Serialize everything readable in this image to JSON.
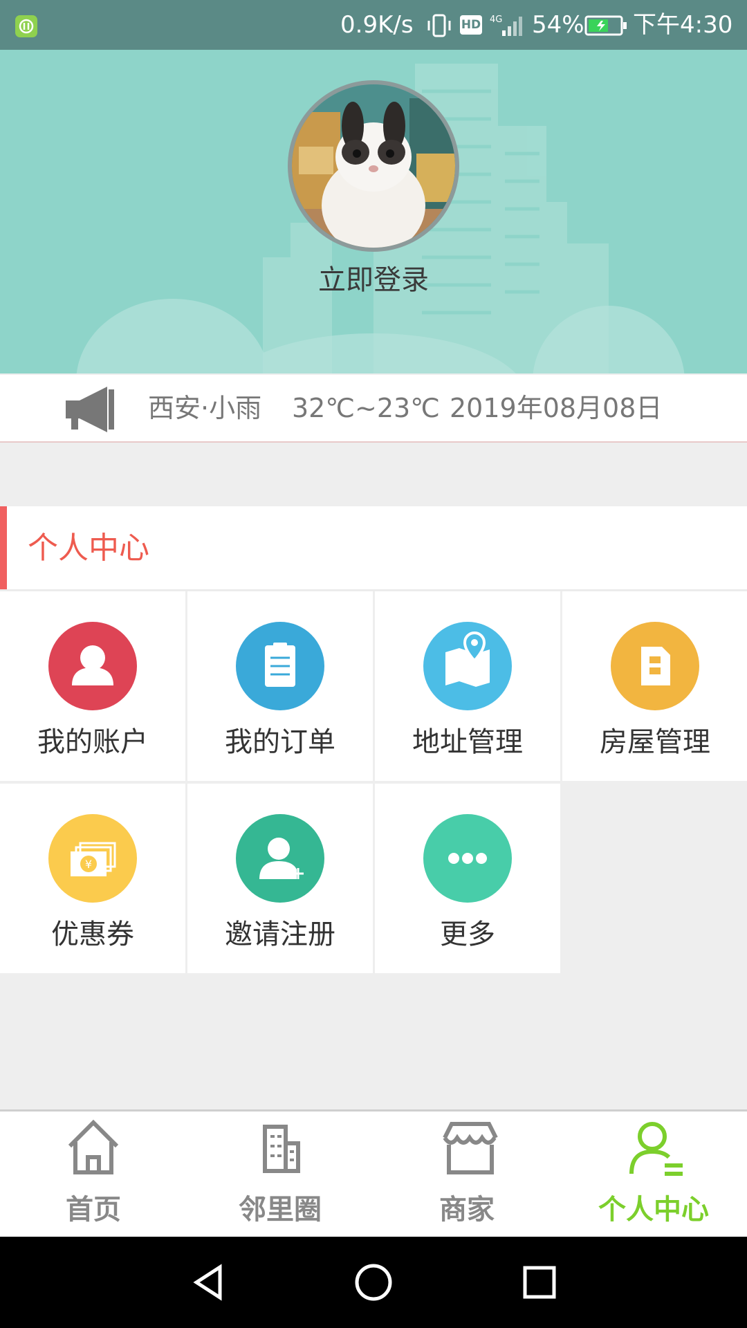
{
  "status_bar": {
    "speed": "0.9K/s",
    "hd": "HD",
    "network": "4G",
    "battery_pct": "54%",
    "time": "下午4:30"
  },
  "header": {
    "avatar_icon": "rabbit-avatar",
    "login_label": "立即登录",
    "bg_color": "#8ed4c9"
  },
  "weather": {
    "icon": "megaphone-icon",
    "city": "西安·小雨",
    "temp": "32℃~23℃",
    "date": "2019年08月08日"
  },
  "section": {
    "title": "个人中心",
    "accent_color": "#f06060"
  },
  "grid": [
    {
      "label": "我的账户",
      "icon": "user-icon",
      "color": "#de4455"
    },
    {
      "label": "我的订单",
      "icon": "clipboard-icon",
      "color": "#3aa9d9"
    },
    {
      "label": "地址管理",
      "icon": "map-pin-icon",
      "color": "#4cbde6"
    },
    {
      "label": "房屋管理",
      "icon": "building-icon",
      "color": "#f2b540"
    },
    {
      "label": "优惠券",
      "icon": "coupon-icon",
      "color": "#fbcb4d"
    },
    {
      "label": "邀请注册",
      "icon": "add-user-icon",
      "color": "#35b793"
    },
    {
      "label": "更多",
      "icon": "more-icon",
      "color": "#48cda9"
    }
  ],
  "bottom_nav": [
    {
      "label": "首页",
      "icon": "home-icon",
      "active": false
    },
    {
      "label": "邻里圈",
      "icon": "buildings-icon",
      "active": false
    },
    {
      "label": "商家",
      "icon": "store-icon",
      "active": false
    },
    {
      "label": "个人中心",
      "icon": "profile-icon",
      "active": true
    }
  ],
  "colors": {
    "active_nav": "#7ccf2c",
    "inactive_nav": "#888888"
  }
}
